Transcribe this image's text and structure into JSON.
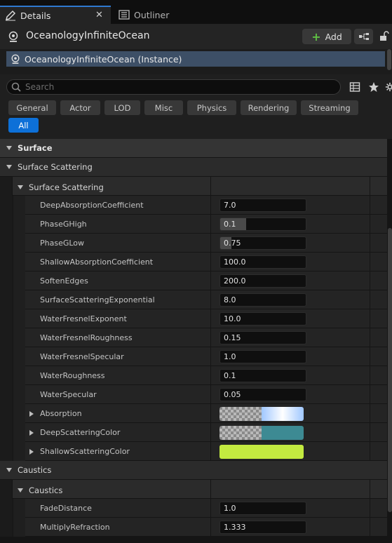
{
  "tabs": [
    {
      "label": "Details",
      "icon": "pencil-icon"
    },
    {
      "label": "Outliner",
      "icon": "outliner-icon"
    }
  ],
  "actor": {
    "name": "OceanologyInfiniteOcean",
    "add_label": "Add"
  },
  "component": {
    "label": "OceanologyInfiniteOcean (Instance)"
  },
  "search": {
    "placeholder": "Search"
  },
  "filters": [
    "General",
    "Actor",
    "LOD",
    "Misc",
    "Physics",
    "Rendering",
    "Streaming",
    "All"
  ],
  "active_filter": "All",
  "sections": {
    "surface": "Surface",
    "surface_scattering": "Surface Scattering",
    "surface_scattering_sub": "Surface Scattering",
    "caustics": "Caustics",
    "caustics_sub": "Caustics"
  },
  "properties": [
    {
      "name": "DeepAbsorptionCoefficient",
      "value": "7.0"
    },
    {
      "name": "PhaseGHigh",
      "value": "0.1",
      "slider_fraction": 0.3
    },
    {
      "name": "PhaseGLow",
      "value": "0.75",
      "slider_fraction": 0.13
    },
    {
      "name": "ShallowAbsorptionCoefficient",
      "value": "100.0"
    },
    {
      "name": "SoftenEdges",
      "value": "200.0"
    },
    {
      "name": "SurfaceScatteringExponential",
      "value": "8.0"
    },
    {
      "name": "WaterFresnelExponent",
      "value": "10.0"
    },
    {
      "name": "WaterFresnelRoughness",
      "value": "0.15"
    },
    {
      "name": "WaterFresnelSpecular",
      "value": "1.0"
    },
    {
      "name": "WaterRoughness",
      "value": "0.1"
    },
    {
      "name": "WaterSpecular",
      "value": "0.05"
    }
  ],
  "color_properties": [
    {
      "name": "Absorption",
      "color": "#9fc7ff"
    },
    {
      "name": "DeepScatteringColor",
      "color": "#3d8a93"
    },
    {
      "name": "ShallowScatteringColor",
      "color": "#c3ea40"
    }
  ],
  "caustics_properties": [
    {
      "name": "FadeDistance",
      "value": "1.0"
    },
    {
      "name": "MultiplyRefraction",
      "value": "1.333"
    }
  ],
  "colors": {
    "accent": "#0d70d8",
    "selection": "#3d4f66",
    "add_plus": "#5fc044"
  }
}
